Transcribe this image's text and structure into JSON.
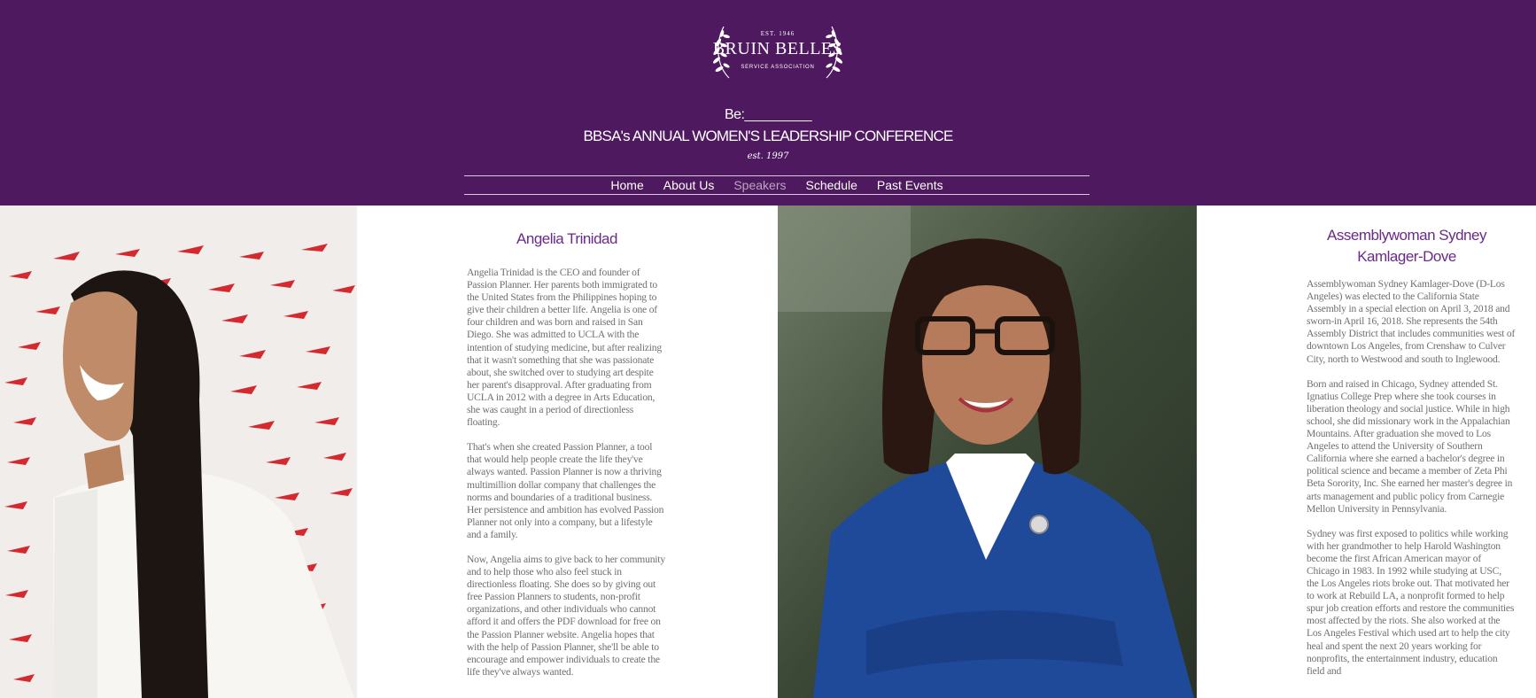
{
  "logo": {
    "est": "EST. 1946",
    "name": "BRUIN BELLES",
    "subtitle": "SERVICE ASSOCIATION"
  },
  "header": {
    "be": "Be:_________",
    "conference": "BBSA's ANNUAL WOMEN'S LEADERSHIP CONFERENCE",
    "established": "est. 1997"
  },
  "nav": {
    "items": [
      {
        "label": "Home",
        "active": false
      },
      {
        "label": "About Us",
        "active": false
      },
      {
        "label": "Speakers",
        "active": true
      },
      {
        "label": "Schedule",
        "active": false
      },
      {
        "label": "Past Events",
        "active": false
      }
    ]
  },
  "speakers": [
    {
      "name": "Angelia Trinidad",
      "bio": [
        "Angelia Trinidad is the CEO and founder of Passion Planner. Her parents both immigrated to the United States from the Philippines hoping to give their children a better life. Angelia is one of four children and was born and raised in San Diego. She was admitted to UCLA with the intention of studying medicine, but after realizing that it wasn't something that she was passionate about, she switched over to studying art despite her parent's disapproval. After graduating from UCLA in 2012 with a degree in Arts Education, she was caught in a period of directionless floating.",
        "That's when she created Passion Planner, a tool that would help people create the life they've always wanted. Passion Planner is now a thriving multimillion dollar company that challenges the norms and boundaries of a traditional business. Her persistence and ambition has evolved Passion Planner not only into a company, but a lifestyle and a family.",
        "Now, Angelia aims to give back to her community and to help those who also feel stuck in directionless floating. She does so by giving out free Passion Planners to students, non-profit organizations, and other individuals who cannot afford it and offers the PDF download for free on the Passion Planner website. Angelia hopes that with the help of Passion Planner, she'll be able to encourage and empower individuals to create the life they've always wanted."
      ]
    },
    {
      "name": "Assemblywoman Sydney Kamlager-Dove",
      "bio": [
        "Assemblywoman Sydney Kamlager-Dove (D-Los Angeles) was elected to the California State Assembly in a special election on April 3, 2018 and sworn-in April 16, 2018. She represents the 54th Assembly District that includes communities west of downtown Los Angeles, from Crenshaw to Culver City, north to Westwood and south to Inglewood.",
        "Born and raised in Chicago, Sydney attended St. Ignatius College Prep where she took courses in liberation theology and social justice. While in high school, she did missionary work in the Appalachian Mountains. After graduation she moved to Los Angeles to attend the University of Southern California where she earned a bachelor's degree in political science and became a member of Zeta Phi Beta Sorority, Inc. She earned her master's degree in arts management and public policy from Carnegie Mellon University in Pennsylvania.",
        "Sydney was first exposed to politics while working with her grandmother to help Harold Washington become the first African American mayor of Chicago in 1983. In 1992 while studying at USC, the Los Angeles riots broke out. That motivated her to work at Rebuild LA, a nonprofit formed to help spur job creation efforts and restore the communities most affected by the riots. She also worked at the Los Angeles Festival which used art to help the city heal and spent the next 20 years working for nonprofits, the entertainment industry, education field and"
      ]
    }
  ],
  "colors": {
    "header_bg": "#4f1960",
    "speaker_name": "#6a2a88",
    "bio_text": "#6f6f6f",
    "nav_active": "#b9a7c1"
  }
}
